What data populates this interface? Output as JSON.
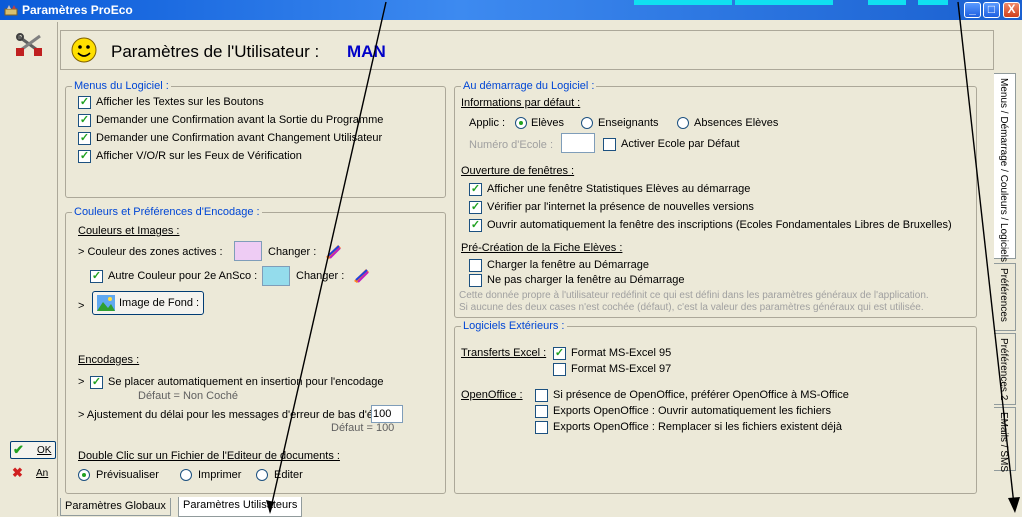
{
  "window": {
    "title": "Paramètres ProEco",
    "minimize_label": "_",
    "maximize_label": "□",
    "close_label": "X"
  },
  "sidebar": {
    "ok_glyph": "✔",
    "ok_label": "OK",
    "cancel_glyph": "✖",
    "cancel_label": "An"
  },
  "header": {
    "title": "Paramètres de l'Utilisateur :",
    "user": "MAN"
  },
  "menus": {
    "title": "Menus du Logiciel :",
    "options": [
      {
        "label": "Afficher les Textes sur les Boutons",
        "checked": true
      },
      {
        "label": "Demander une Confirmation avant la Sortie du Programme",
        "checked": true
      },
      {
        "label": "Demander une Confirmation avant Changement Utilisateur",
        "checked": true
      },
      {
        "label": "Afficher V/O/R sur les Feux de Vérification",
        "checked": true
      }
    ]
  },
  "couleurs": {
    "title": "Couleurs et Préférences d'Encodage :",
    "images_heading": "Couleurs et Images :",
    "zones_label": "> Couleur des zones actives :",
    "zones_color": "#eeccf4",
    "changer_1": "Changer :",
    "autre_label": "Autre Couleur pour 2e AnSco :",
    "autre_checked": true,
    "autre_color": "#94dcec",
    "changer_2": "Changer :",
    "image_prefix": ">",
    "image_button": "Image de Fond :",
    "encodages_heading": "Encodages :",
    "insertion_prefix": ">",
    "insertion_label": "Se placer automatiquement en insertion pour l'encodage",
    "insertion_checked": true,
    "insertion_default": "Défaut = Non Coché",
    "delai_label": "> Ajustement du délai pour les messages d'erreur de bas d'écran :",
    "delai_value": "100",
    "delai_default": "Défaut = 100",
    "dblclick_heading": "Double Clic sur un Fichier de l'Editeur de documents :",
    "dblclick_options": [
      {
        "label": "Prévisualiser",
        "selected": true
      },
      {
        "label": "Imprimer",
        "selected": false
      },
      {
        "label": "Editer",
        "selected": false
      }
    ]
  },
  "demarrage": {
    "title": "Au démarrage du Logiciel :",
    "info_heading": "Informations par défaut :",
    "applic_label": "Applic :",
    "applic_options": [
      {
        "label": "Elèves",
        "selected": true
      },
      {
        "label": "Enseignants",
        "selected": false
      },
      {
        "label": "Absences Elèves",
        "selected": false
      }
    ],
    "ecole_label": "Numéro d'Ecole :",
    "ecole_value": "",
    "activer_label": "Activer Ecole par Défaut",
    "activer_checked": false,
    "fenetres_heading": "Ouverture de fenêtres :",
    "fenetres": [
      {
        "label": "Afficher une fenêtre Statistiques Elèves au démarrage",
        "checked": true
      },
      {
        "label": "Vérifier par l'internet la présence de nouvelles versions",
        "checked": true
      },
      {
        "label": "Ouvrir automatiquement la fenêtre des inscriptions (Ecoles Fondamentales Libres de Bruxelles)",
        "checked": true
      }
    ],
    "fiche_heading": "Pré-Création de la Fiche Elèves :",
    "fiche_options": [
      {
        "label": "Charger la fenêtre au Démarrage",
        "checked": false
      },
      {
        "label": "Ne pas charger la fenêtre au Démarrage",
        "checked": false
      }
    ],
    "note_1": "Cette donnée propre à l'utilisateur redéfinit ce qui est défini dans les paramètres généraux de l'application.",
    "note_2": "Si aucune des deux cases n'est cochée (défaut), c'est la valeur des paramètres généraux qui est utilisée."
  },
  "logiciels": {
    "title": "Logiciels Extérieurs :",
    "excel_heading": "Transferts Excel :",
    "excel_options": [
      {
        "label": "Format MS-Excel 95",
        "checked": true
      },
      {
        "label": "Format MS-Excel 97",
        "checked": false
      }
    ],
    "oo_heading": "OpenOffice :",
    "oo_options": [
      {
        "label": "Si présence de OpenOffice, préférer OpenOffice à MS-Office",
        "checked": false
      },
      {
        "label": "Exports OpenOffice : Ouvrir automatiquement les fichiers",
        "checked": false
      },
      {
        "label": "Exports OpenOffice  : Remplacer si les fichiers existent déjà",
        "checked": false
      }
    ]
  },
  "vertical_tabs": [
    "Menus / Démarrage / Couleurs / Logiciels",
    "Préférences",
    "Préférences 2",
    "EMails / SMS"
  ],
  "bottom_tabs": [
    "Paramètres Globaux",
    "Paramètres Utilisateurs"
  ],
  "icons": {
    "app": "gear-tools-icon",
    "tools": "tools-icon",
    "smiley": "smiley-icon",
    "pencil": "pencil-icon",
    "image": "landscape-image-icon"
  }
}
